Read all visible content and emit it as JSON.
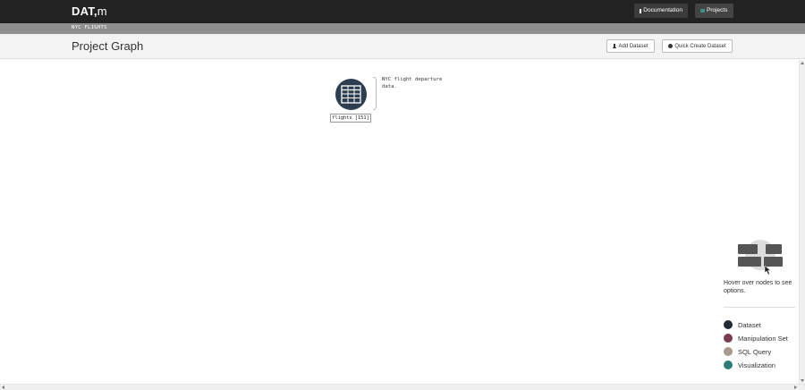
{
  "topbar": {
    "brand_main": "DAT,",
    "brand_suffix": "m",
    "nav": [
      {
        "label": "Documentation",
        "icon": "book-icon"
      },
      {
        "label": "Projects",
        "icon": "folder-icon"
      }
    ]
  },
  "subbar": {
    "crumb": "NYC FLIGHTS"
  },
  "header": {
    "title": "Project Graph",
    "add_dataset": "Add Dataset",
    "quick_create": "Quick Create Dataset"
  },
  "graph": {
    "nodes": [
      {
        "label": "flights [151]",
        "description": [
          "NYC flight departure",
          "data."
        ],
        "type": "Dataset"
      }
    ]
  },
  "help": {
    "text": "Hover over nodes to see options."
  },
  "legend": [
    {
      "label": "Dataset",
      "color": "#222a33"
    },
    {
      "label": "Manipulation Set",
      "color": "#7a3b4f"
    },
    {
      "label": "SQL Query",
      "color": "#a69b8c"
    },
    {
      "label": "Visualization",
      "color": "#2e7c78"
    }
  ],
  "colors": {
    "topbar": "#222222",
    "subbar": "#8f8f8f",
    "node": "#2d3e50"
  }
}
